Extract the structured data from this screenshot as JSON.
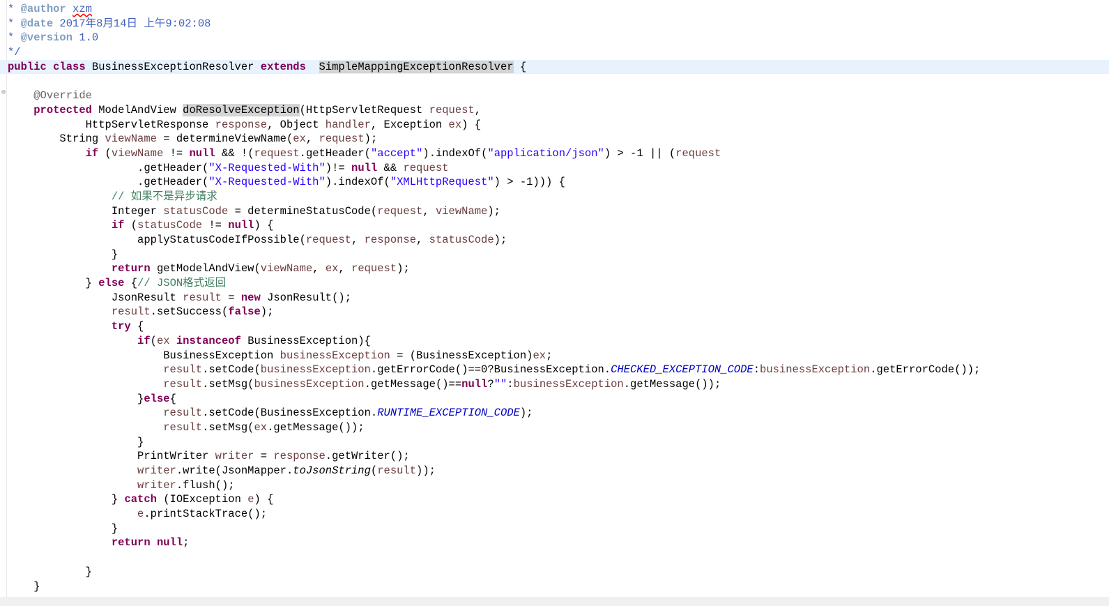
{
  "editor": {
    "lines": [
      [
        {
          "t": "* ",
          "c": "doc"
        },
        {
          "t": "@author",
          "c": "tag"
        },
        {
          "t": " ",
          "c": "doc"
        },
        {
          "t": "xzm",
          "c": "doc spell"
        }
      ],
      [
        {
          "t": "* ",
          "c": "doc"
        },
        {
          "t": "@date",
          "c": "tag"
        },
        {
          "t": " 2017年8月14日 上午9:02:08",
          "c": "doc"
        }
      ],
      [
        {
          "t": "* ",
          "c": "doc"
        },
        {
          "t": "@version",
          "c": "tag"
        },
        {
          "t": " 1.0",
          "c": "doc"
        }
      ],
      [
        {
          "t": "*/",
          "c": "doc"
        }
      ],
      [
        {
          "t": "public class",
          "c": "kw"
        },
        {
          "t": " BusinessExceptionResolver ",
          "c": ""
        },
        {
          "t": "extends",
          "c": "kw"
        },
        {
          "t": "  ",
          "c": ""
        },
        {
          "t": "SimpleMappingExceptionResolver",
          "c": "hl"
        },
        {
          "t": " {",
          "c": ""
        }
      ],
      [],
      [
        {
          "t": "    ",
          "c": ""
        },
        {
          "t": "@Override",
          "c": "ann"
        }
      ],
      [
        {
          "t": "    ",
          "c": ""
        },
        {
          "t": "protected",
          "c": "kw"
        },
        {
          "t": " ModelAndView ",
          "c": ""
        },
        {
          "t": "doResolveException",
          "c": "hl2"
        },
        {
          "t": "(HttpServletRequest ",
          "c": ""
        },
        {
          "t": "request",
          "c": "var"
        },
        {
          "t": ",",
          "c": ""
        }
      ],
      [
        {
          "t": "            HttpServletResponse ",
          "c": ""
        },
        {
          "t": "response",
          "c": "var"
        },
        {
          "t": ", Object ",
          "c": ""
        },
        {
          "t": "handler",
          "c": "var"
        },
        {
          "t": ", Exception ",
          "c": ""
        },
        {
          "t": "ex",
          "c": "var"
        },
        {
          "t": ") {",
          "c": ""
        }
      ],
      [
        {
          "t": "        String ",
          "c": ""
        },
        {
          "t": "viewName",
          "c": "var"
        },
        {
          "t": " = determineViewName(",
          "c": ""
        },
        {
          "t": "ex",
          "c": "var"
        },
        {
          "t": ", ",
          "c": ""
        },
        {
          "t": "request",
          "c": "var"
        },
        {
          "t": ");",
          "c": ""
        }
      ],
      [
        {
          "t": "            ",
          "c": ""
        },
        {
          "t": "if",
          "c": "kw"
        },
        {
          "t": " (",
          "c": ""
        },
        {
          "t": "viewName",
          "c": "var"
        },
        {
          "t": " != ",
          "c": ""
        },
        {
          "t": "null",
          "c": "kw"
        },
        {
          "t": " && !(",
          "c": ""
        },
        {
          "t": "request",
          "c": "var"
        },
        {
          "t": ".getHeader(",
          "c": ""
        },
        {
          "t": "\"accept\"",
          "c": "str"
        },
        {
          "t": ").indexOf(",
          "c": ""
        },
        {
          "t": "\"application/json\"",
          "c": "str"
        },
        {
          "t": ") > -1 || (",
          "c": ""
        },
        {
          "t": "request",
          "c": "var"
        }
      ],
      [
        {
          "t": "                    .getHeader(",
          "c": ""
        },
        {
          "t": "\"X-Requested-With\"",
          "c": "str"
        },
        {
          "t": ")!= ",
          "c": ""
        },
        {
          "t": "null",
          "c": "kw"
        },
        {
          "t": " && ",
          "c": ""
        },
        {
          "t": "request",
          "c": "var"
        }
      ],
      [
        {
          "t": "                    .getHeader(",
          "c": ""
        },
        {
          "t": "\"X-Requested-With\"",
          "c": "str"
        },
        {
          "t": ").indexOf(",
          "c": ""
        },
        {
          "t": "\"XMLHttpRequest\"",
          "c": "str"
        },
        {
          "t": ") > -1))) {",
          "c": ""
        }
      ],
      [
        {
          "t": "                ",
          "c": ""
        },
        {
          "t": "// 如果不是异步请求",
          "c": "cmt"
        }
      ],
      [
        {
          "t": "                Integer ",
          "c": ""
        },
        {
          "t": "statusCode",
          "c": "var"
        },
        {
          "t": " = determineStatusCode(",
          "c": ""
        },
        {
          "t": "request",
          "c": "var"
        },
        {
          "t": ", ",
          "c": ""
        },
        {
          "t": "viewName",
          "c": "var"
        },
        {
          "t": ");",
          "c": ""
        }
      ],
      [
        {
          "t": "                ",
          "c": ""
        },
        {
          "t": "if",
          "c": "kw"
        },
        {
          "t": " (",
          "c": ""
        },
        {
          "t": "statusCode",
          "c": "var"
        },
        {
          "t": " != ",
          "c": ""
        },
        {
          "t": "null",
          "c": "kw"
        },
        {
          "t": ") {",
          "c": ""
        }
      ],
      [
        {
          "t": "                    applyStatusCodeIfPossible(",
          "c": ""
        },
        {
          "t": "request",
          "c": "var"
        },
        {
          "t": ", ",
          "c": ""
        },
        {
          "t": "response",
          "c": "var"
        },
        {
          "t": ", ",
          "c": ""
        },
        {
          "t": "statusCode",
          "c": "var"
        },
        {
          "t": ");",
          "c": ""
        }
      ],
      [
        {
          "t": "                }",
          "c": ""
        }
      ],
      [
        {
          "t": "                ",
          "c": ""
        },
        {
          "t": "return",
          "c": "kw"
        },
        {
          "t": " getModelAndView(",
          "c": ""
        },
        {
          "t": "viewName",
          "c": "var"
        },
        {
          "t": ", ",
          "c": ""
        },
        {
          "t": "ex",
          "c": "var"
        },
        {
          "t": ", ",
          "c": ""
        },
        {
          "t": "request",
          "c": "var"
        },
        {
          "t": ");",
          "c": ""
        }
      ],
      [
        {
          "t": "            } ",
          "c": ""
        },
        {
          "t": "else",
          "c": "kw"
        },
        {
          "t": " {",
          "c": ""
        },
        {
          "t": "// JSON格式返回",
          "c": "cmt"
        }
      ],
      [
        {
          "t": "                JsonResult ",
          "c": ""
        },
        {
          "t": "result",
          "c": "var"
        },
        {
          "t": " = ",
          "c": ""
        },
        {
          "t": "new",
          "c": "kw"
        },
        {
          "t": " JsonResult();",
          "c": ""
        }
      ],
      [
        {
          "t": "                ",
          "c": ""
        },
        {
          "t": "result",
          "c": "var"
        },
        {
          "t": ".setSuccess(",
          "c": ""
        },
        {
          "t": "false",
          "c": "kw"
        },
        {
          "t": ");",
          "c": ""
        }
      ],
      [
        {
          "t": "                ",
          "c": ""
        },
        {
          "t": "try",
          "c": "kw"
        },
        {
          "t": " {",
          "c": ""
        }
      ],
      [
        {
          "t": "                    ",
          "c": ""
        },
        {
          "t": "if",
          "c": "kw"
        },
        {
          "t": "(",
          "c": ""
        },
        {
          "t": "ex",
          "c": "var"
        },
        {
          "t": " ",
          "c": ""
        },
        {
          "t": "instanceof",
          "c": "kw"
        },
        {
          "t": " BusinessException){",
          "c": ""
        }
      ],
      [
        {
          "t": "                        BusinessException ",
          "c": ""
        },
        {
          "t": "businessException",
          "c": "var"
        },
        {
          "t": " = (BusinessException)",
          "c": ""
        },
        {
          "t": "ex",
          "c": "var"
        },
        {
          "t": ";",
          "c": ""
        }
      ],
      [
        {
          "t": "                        ",
          "c": ""
        },
        {
          "t": "result",
          "c": "var"
        },
        {
          "t": ".setCode(",
          "c": ""
        },
        {
          "t": "businessException",
          "c": "var"
        },
        {
          "t": ".getErrorCode()==0?BusinessException.",
          "c": ""
        },
        {
          "t": "CHECKED_EXCEPTION_CODE",
          "c": "fld"
        },
        {
          "t": ":",
          "c": ""
        },
        {
          "t": "businessException",
          "c": "var"
        },
        {
          "t": ".getErrorCode());",
          "c": ""
        }
      ],
      [
        {
          "t": "                        ",
          "c": ""
        },
        {
          "t": "result",
          "c": "var"
        },
        {
          "t": ".setMsg(",
          "c": ""
        },
        {
          "t": "businessException",
          "c": "var"
        },
        {
          "t": ".getMessage()==",
          "c": ""
        },
        {
          "t": "null",
          "c": "kw"
        },
        {
          "t": "?",
          "c": ""
        },
        {
          "t": "\"\"",
          "c": "str"
        },
        {
          "t": ":",
          "c": ""
        },
        {
          "t": "businessException",
          "c": "var"
        },
        {
          "t": ".getMessage());",
          "c": ""
        }
      ],
      [
        {
          "t": "                    }",
          "c": ""
        },
        {
          "t": "else",
          "c": "kw"
        },
        {
          "t": "{",
          "c": ""
        }
      ],
      [
        {
          "t": "                        ",
          "c": ""
        },
        {
          "t": "result",
          "c": "var"
        },
        {
          "t": ".setCode(BusinessException.",
          "c": ""
        },
        {
          "t": "RUNTIME_EXCEPTION_CODE",
          "c": "fld"
        },
        {
          "t": ");",
          "c": ""
        }
      ],
      [
        {
          "t": "                        ",
          "c": ""
        },
        {
          "t": "result",
          "c": "var"
        },
        {
          "t": ".setMsg(",
          "c": ""
        },
        {
          "t": "ex",
          "c": "var"
        },
        {
          "t": ".getMessage());",
          "c": ""
        }
      ],
      [
        {
          "t": "                    }",
          "c": ""
        }
      ],
      [
        {
          "t": "                    PrintWriter ",
          "c": ""
        },
        {
          "t": "writer",
          "c": "var"
        },
        {
          "t": " = ",
          "c": ""
        },
        {
          "t": "response",
          "c": "var"
        },
        {
          "t": ".getWriter();",
          "c": ""
        }
      ],
      [
        {
          "t": "                    ",
          "c": ""
        },
        {
          "t": "writer",
          "c": "var"
        },
        {
          "t": ".write(JsonMapper.",
          "c": ""
        },
        {
          "t": "toJsonString",
          "c": "ital"
        },
        {
          "t": "(",
          "c": ""
        },
        {
          "t": "result",
          "c": "var"
        },
        {
          "t": "));",
          "c": ""
        }
      ],
      [
        {
          "t": "                    ",
          "c": ""
        },
        {
          "t": "writer",
          "c": "var"
        },
        {
          "t": ".flush();",
          "c": ""
        }
      ],
      [
        {
          "t": "                } ",
          "c": ""
        },
        {
          "t": "catch",
          "c": "kw"
        },
        {
          "t": " (IOException ",
          "c": ""
        },
        {
          "t": "e",
          "c": "var"
        },
        {
          "t": ") {",
          "c": ""
        }
      ],
      [
        {
          "t": "                    ",
          "c": ""
        },
        {
          "t": "e",
          "c": "var"
        },
        {
          "t": ".printStackTrace();",
          "c": ""
        }
      ],
      [
        {
          "t": "                }",
          "c": ""
        }
      ],
      [
        {
          "t": "                ",
          "c": ""
        },
        {
          "t": "return null",
          "c": "kw"
        },
        {
          "t": ";",
          "c": ""
        }
      ],
      [],
      [
        {
          "t": "            }",
          "c": ""
        }
      ],
      [
        {
          "t": "    }",
          "c": ""
        }
      ]
    ],
    "current_line_index": 4,
    "fold_marker_glyph": "⊖"
  }
}
